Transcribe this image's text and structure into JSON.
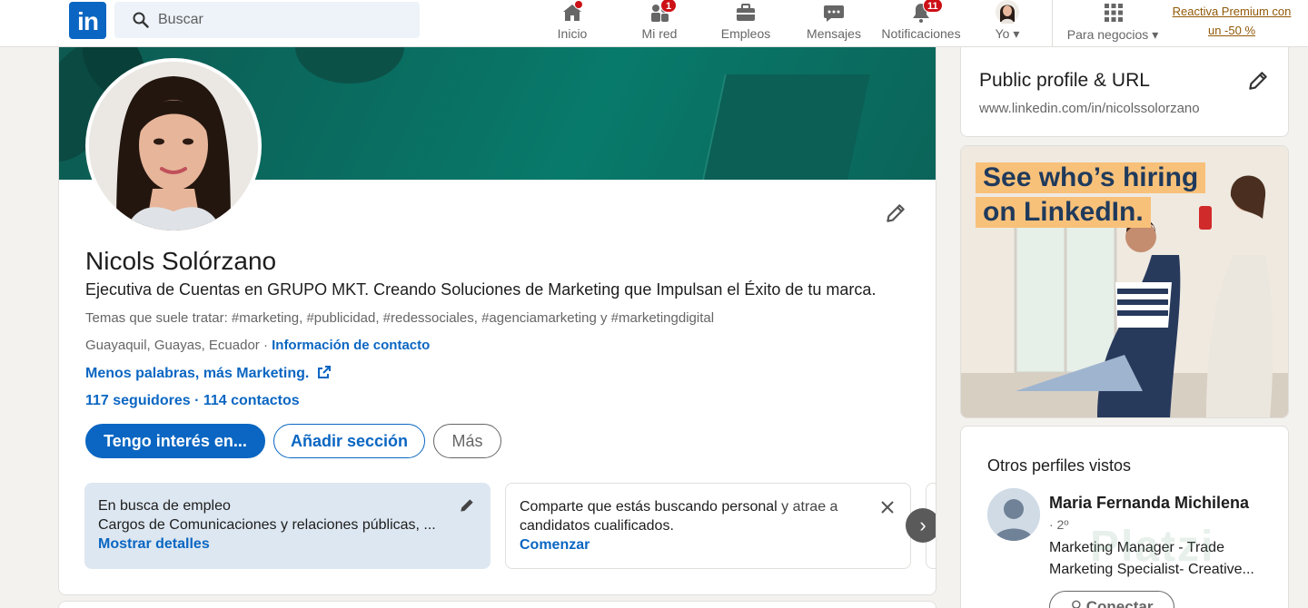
{
  "nav": {
    "search_placeholder": "Buscar",
    "items": [
      {
        "label": "Inicio",
        "badge": ""
      },
      {
        "label": "Mi red",
        "badge": "1"
      },
      {
        "label": "Empleos",
        "badge": ""
      },
      {
        "label": "Mensajes",
        "badge": ""
      },
      {
        "label": "Notificaciones",
        "badge": "11"
      },
      {
        "label": "Yo",
        "badge": ""
      },
      {
        "label": "Para negocios",
        "badge": ""
      }
    ],
    "premium_line1": "Reactiva Premium con",
    "premium_line2": "un -50 %"
  },
  "profile": {
    "name": "Nicols Solórzano",
    "headline": "Ejecutiva de Cuentas en GRUPO MKT. Creando Soluciones de Marketing que Impulsan el Éxito de tu marca.",
    "topics": "Temas que suele tratar: #marketing, #publicidad, #redessociales, #agenciamarketing y #marketingdigital",
    "location": "Guayaquil, Guayas, Ecuador · ",
    "contact_link": "Información de contacto",
    "website": "Menos palabras, más Marketing.",
    "followers": "117 seguidores",
    "connections": " · 114 contactos",
    "btn_open_to": "Tengo interés en...",
    "btn_add_section": "Añadir sección",
    "btn_more": "Más"
  },
  "panels": {
    "job_title": "En busca de empleo",
    "job_text": "Cargos de Comunicaciones y relaciones públicas, ...",
    "job_link": "Mostrar detalles",
    "hire_title_bold": "Comparte que estás buscando personal",
    "hire_title_rest": " y atrae a",
    "hire_text": "candidatos cualificados.",
    "hire_link": "Comenzar"
  },
  "sidebar": {
    "public_title": "Public profile & URL",
    "public_url": "www.linkedin.com/in/nicolssolorzano",
    "ad_line1": "See who’s hiring",
    "ad_line2": "on LinkedIn.",
    "others_title": "Otros perfiles vistos",
    "other_name": "Maria Fernanda Michilena",
    "other_degree": "· 2º",
    "other_headline": "Marketing Manager - Trade Marketing Specialist- Creative...",
    "connect_label": "Conectar"
  },
  "watermark": "Platzi",
  "colors": {
    "brand": "#0a66c2",
    "badge": "#cc1016",
    "premium": "#915907"
  }
}
